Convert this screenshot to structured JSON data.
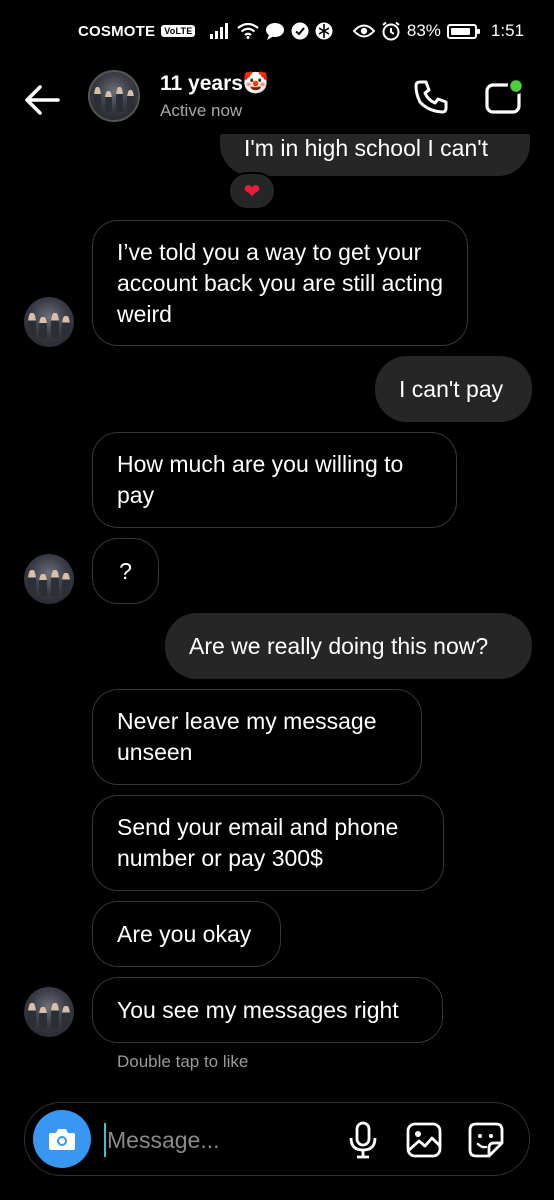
{
  "status_bar": {
    "carrier": "COSMOTE",
    "volte": "VoLTE",
    "battery": "83%",
    "time": "1:51"
  },
  "header": {
    "contact_name": "11 years🤡",
    "contact_status": "Active now"
  },
  "messages": [
    {
      "side": "out",
      "text": "I'm in high school I can't"
    },
    {
      "reaction": "❤"
    },
    {
      "side": "in",
      "text": "I’ve told you a way to get your account back you are still acting weird"
    },
    {
      "side": "out",
      "text": "I can't pay"
    },
    {
      "side": "in",
      "text": "How much are you willing to pay"
    },
    {
      "side": "in",
      "text": "?"
    },
    {
      "side": "out",
      "text": "Are we really doing this now?"
    },
    {
      "side": "in",
      "text": "Never leave my message unseen"
    },
    {
      "side": "in",
      "text": "Send your email and phone number or pay 300$"
    },
    {
      "side": "in",
      "text": "Are you okay"
    },
    {
      "side": "in",
      "text": "You see my messages right"
    }
  ],
  "hint": "Double tap to like",
  "composer": {
    "placeholder": "Message..."
  },
  "colors": {
    "background": "#000000",
    "outgoing_bubble": "#262626",
    "camera_button": "#3897f0",
    "active_dot": "#4cd037",
    "heart": "#ed1c3a"
  }
}
